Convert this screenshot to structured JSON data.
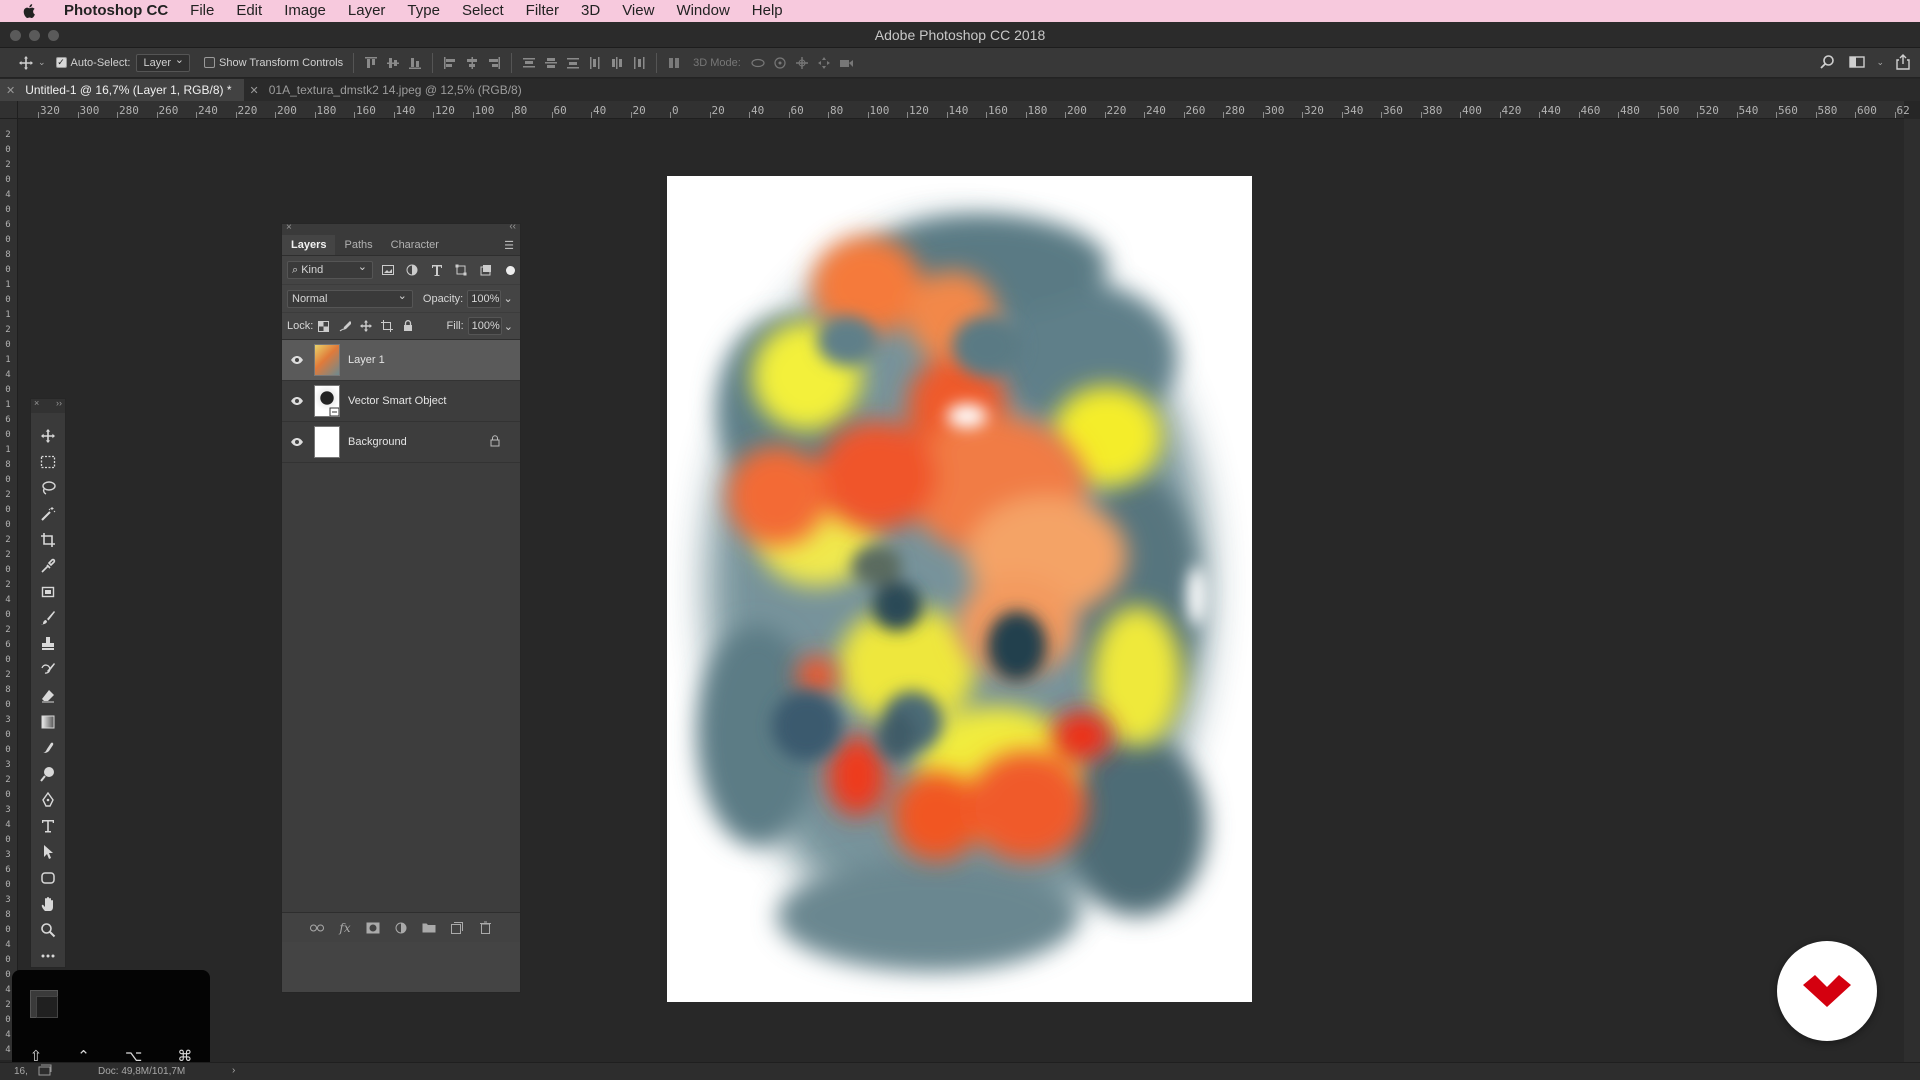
{
  "menubar": {
    "app_name": "Photoshop CC",
    "items": [
      "File",
      "Edit",
      "Image",
      "Layer",
      "Type",
      "Select",
      "Filter",
      "3D",
      "View",
      "Window",
      "Help"
    ]
  },
  "window": {
    "title": "Adobe Photoshop CC 2018"
  },
  "options_bar": {
    "auto_select_label": "Auto-Select:",
    "auto_select_checked": true,
    "auto_select_value": "Layer",
    "transform_controls_label": "Show Transform Controls",
    "mode_3d_label": "3D Mode:"
  },
  "tabs": [
    {
      "label": "Untitled-1 @ 16,7% (Layer 1, RGB/8) *",
      "active": true
    },
    {
      "label": "01A_textura_dmstk2 14.jpeg @ 12,5% (RGB/8)",
      "active": false
    }
  ],
  "ruler": {
    "h_labels": [
      "320",
      "300",
      "280",
      "260",
      "240",
      "220",
      "200",
      "180",
      "160",
      "140",
      "120",
      "100",
      "80",
      "60",
      "40",
      "20",
      "0",
      "20",
      "40",
      "60",
      "80",
      "100",
      "120",
      "140",
      "160",
      "180",
      "200",
      "220",
      "240",
      "260",
      "280",
      "300",
      "320",
      "340",
      "360",
      "380",
      "400",
      "420",
      "440",
      "460",
      "480",
      "500",
      "520",
      "540",
      "560",
      "580",
      "600",
      "62"
    ],
    "v_labels": [
      "2",
      "0",
      "2",
      "0",
      "4",
      "0",
      "6",
      "0",
      "8",
      "0",
      "1",
      "0",
      "1",
      "2",
      "0",
      "1",
      "4",
      "0",
      "1",
      "6",
      "0",
      "1",
      "8",
      "0",
      "2",
      "0",
      "0",
      "2",
      "2",
      "0",
      "2",
      "4",
      "0",
      "2",
      "6",
      "0",
      "2",
      "8",
      "0",
      "3",
      "0",
      "0",
      "3",
      "2",
      "0",
      "3",
      "4",
      "0",
      "3",
      "6",
      "0",
      "3",
      "8",
      "0",
      "4",
      "0",
      "0",
      "4",
      "2",
      "0",
      "4",
      "4"
    ]
  },
  "layers_panel": {
    "tabs": [
      "Layers",
      "Paths",
      "Character"
    ],
    "active_tab": "Layers",
    "filter_kind": "Kind",
    "blend_mode": "Normal",
    "opacity_label": "Opacity:",
    "opacity_value": "100%",
    "lock_label": "Lock:",
    "fill_label": "Fill:",
    "fill_value": "100%",
    "layers": [
      {
        "name": "Layer 1",
        "selected": true,
        "visible": true,
        "locked": false
      },
      {
        "name": "Vector Smart Object",
        "selected": false,
        "visible": true,
        "locked": false
      },
      {
        "name": "Background",
        "selected": false,
        "visible": true,
        "locked": true
      }
    ]
  },
  "toolbar": {
    "tools": [
      "move-tool-icon",
      "marquee-tool-icon",
      "lasso-tool-icon",
      "magic-wand-icon",
      "crop-tool-icon",
      "eyedropper-icon",
      "frame-tool-icon",
      "brush-tool-icon",
      "stamp-tool-icon",
      "history-brush-icon",
      "eraser-icon",
      "gradient-icon",
      "smudge-icon",
      "dodge-icon",
      "pen-tool-icon",
      "type-tool-icon",
      "path-select-icon",
      "shape-tool-icon",
      "hand-tool-icon",
      "zoom-tool-icon",
      "more-tools-icon"
    ]
  },
  "status_bar": {
    "zoom": "16,",
    "doc_info": "Doc: 49,8M/101,7M"
  },
  "colors": {
    "menubar_bg": "#f7c9dd",
    "badge_red": "#d4000f"
  }
}
